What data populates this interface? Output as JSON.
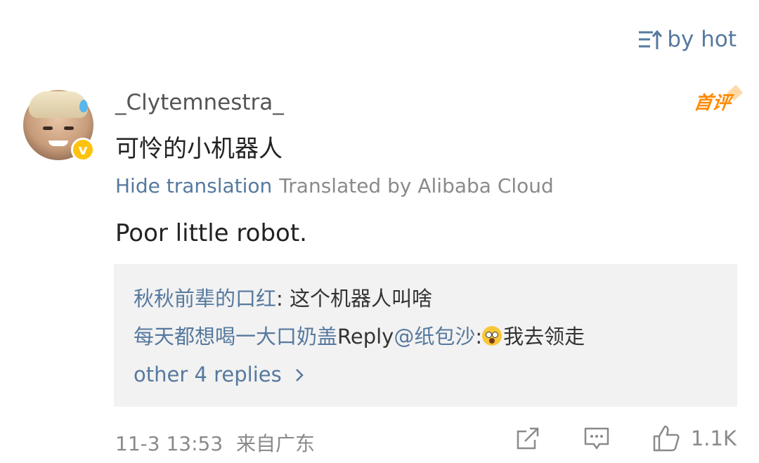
{
  "sort": {
    "label": "by hot"
  },
  "comment": {
    "username": "_Clytemnestra_",
    "badge": "首评",
    "original_text": "可怜的小机器人",
    "hide_translation": "Hide translation",
    "translated_by": "Translated by Alibaba Cloud",
    "translation": "Poor little robot."
  },
  "replies": {
    "items": [
      {
        "name": "秋秋前辈的口红",
        "separator": ": ",
        "text": "这个机器人叫啥"
      },
      {
        "name": "每天都想喝一大口奶盖",
        "reply_word": "Reply",
        "mention": "@纸包沙",
        "separator": ":",
        "emoji": "flushed-emoji",
        "text": "我去领走"
      }
    ],
    "more": "other 4 replies"
  },
  "footer": {
    "time": "11-3 13:53",
    "location": "来自广东",
    "like_count": "1.1K"
  },
  "colors": {
    "link": "#56799f",
    "badge": "#ff8a00",
    "verified": "#ffc20e",
    "muted": "#8a8a8a"
  }
}
